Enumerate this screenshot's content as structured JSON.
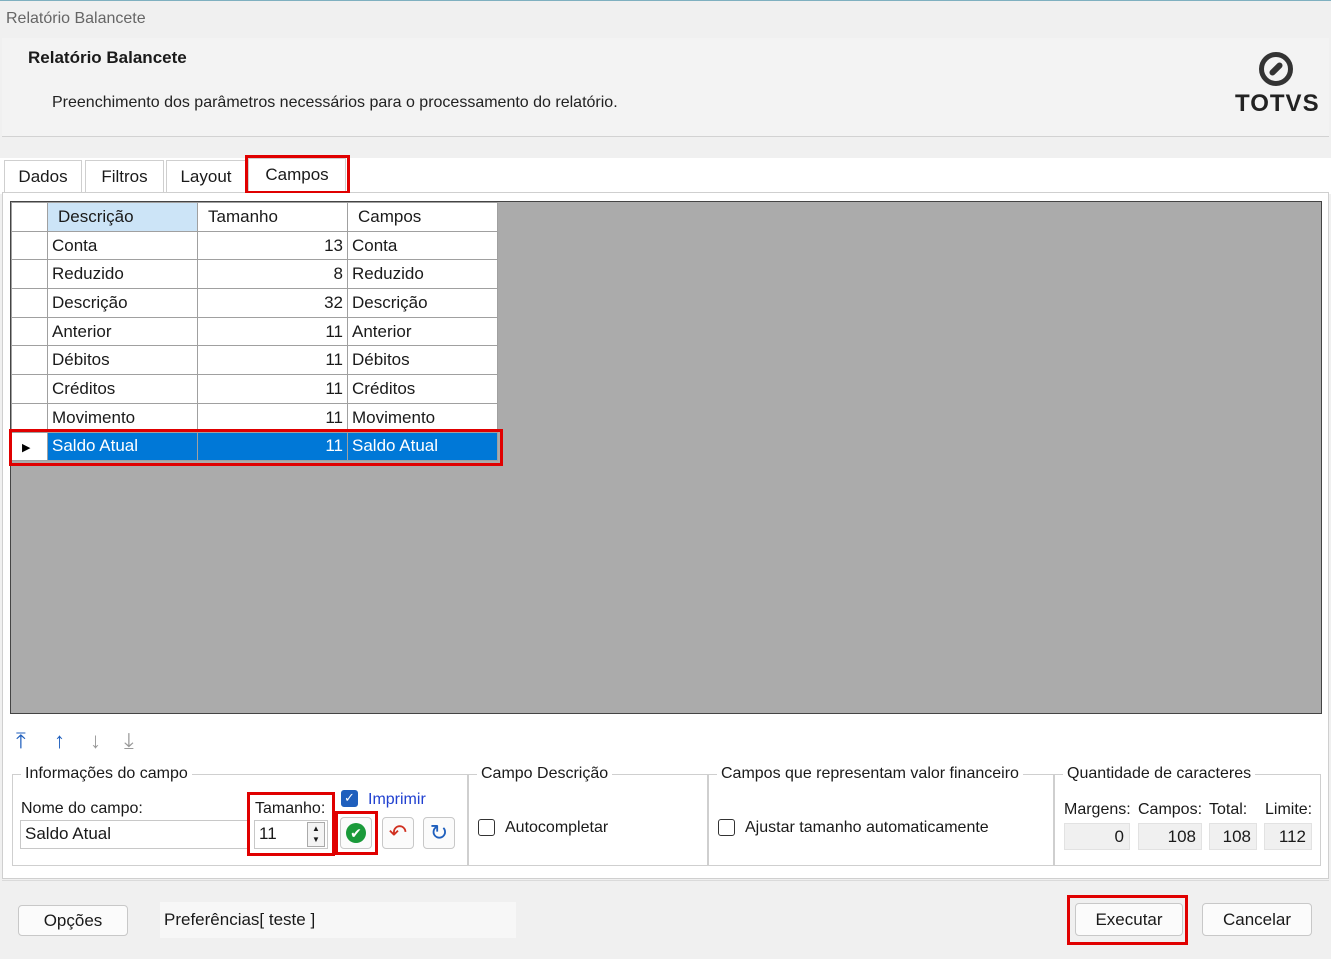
{
  "window": {
    "title": "Relatório Balancete"
  },
  "header": {
    "title": "Relatório Balancete",
    "subtitle": "Preenchimento dos parâmetros necessários para o processamento do relatório.",
    "logo_text": "TOTVS"
  },
  "tabs": [
    {
      "label": "Dados"
    },
    {
      "label": "Filtros"
    },
    {
      "label": "Layout"
    },
    {
      "label": "Campos"
    }
  ],
  "grid": {
    "columns": [
      "Descrição",
      "Tamanho",
      "Campos"
    ],
    "rows": [
      {
        "descricao": "Conta",
        "tamanho": "13",
        "campos": "Conta"
      },
      {
        "descricao": "Reduzido",
        "tamanho": "8",
        "campos": "Reduzido"
      },
      {
        "descricao": "Descrição",
        "tamanho": "32",
        "campos": "Descrição"
      },
      {
        "descricao": "Anterior",
        "tamanho": "11",
        "campos": "Anterior"
      },
      {
        "descricao": "Débitos",
        "tamanho": "11",
        "campos": "Débitos"
      },
      {
        "descricao": "Créditos",
        "tamanho": "11",
        "campos": "Créditos"
      },
      {
        "descricao": "Movimento",
        "tamanho": "11",
        "campos": "Movimento"
      },
      {
        "descricao": "Saldo Atual",
        "tamanho": "11",
        "campos": "Saldo Atual"
      }
    ]
  },
  "move_buttons": [
    "move-top-icon",
    "move-up-icon",
    "move-down-icon",
    "move-bottom-icon"
  ],
  "campo_info": {
    "legend": "Informações do campo",
    "nome_label": "Nome do campo:",
    "nome_value": "Saldo Atual",
    "tamanho_label": "Tamanho:",
    "tamanho_value": "11",
    "imprimir_label": "Imprimir",
    "imprimir_checked": true
  },
  "campo_descricao": {
    "legend": "Campo Descrição",
    "autocompletar_label": "Autocompletar"
  },
  "valor_financeiro": {
    "legend": "Campos que representam valor financeiro",
    "ajustar_label": "Ajustar tamanho automaticamente"
  },
  "quantidade": {
    "legend": "Quantidade de caracteres",
    "margens_label": "Margens:",
    "margens_value": "0",
    "campos_label": "Campos:",
    "campos_value": "108",
    "total_label": "Total:",
    "total_value": "108",
    "limite_label": "Limite:",
    "limite_value": "112"
  },
  "footer": {
    "opcoes_label": "Opções",
    "preferencias_text": "Preferências[ teste ]",
    "executar_label": "Executar",
    "cancelar_label": "Cancelar"
  },
  "colors": {
    "selection": "#0078d7",
    "highlight": "#e00000",
    "accent_blue": "#1f5fbd"
  }
}
